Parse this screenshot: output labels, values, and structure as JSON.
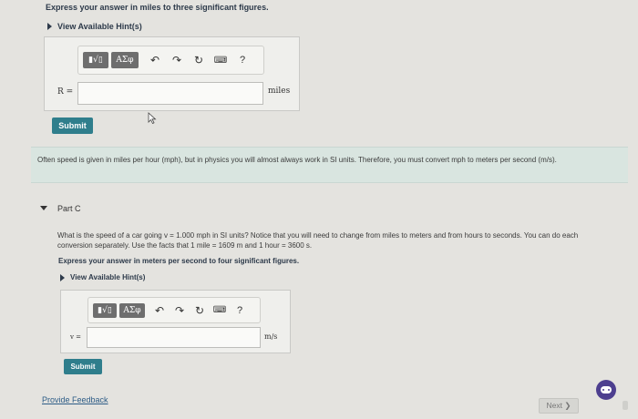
{
  "partB": {
    "instruction": "Express your answer in miles to three significant figures.",
    "hints_label": "View Available Hint(s)",
    "var_label": "R =",
    "unit": "miles",
    "submit_label": "Submit"
  },
  "toolbar": {
    "template_label": "▮√▯",
    "greek_label": "ΑΣφ",
    "help_label": "?"
  },
  "info_text": "Often speed is given in miles per hour (mph), but in physics you will almost always work in SI units. Therefore, you must convert mph to meters per second (m/s).",
  "partC": {
    "title": "Part C",
    "question": "What is the speed of a car going v = 1.000 mph in SI units? Notice that you will need to change from miles to meters and from hours to seconds. You can do each conversion separately. Use the facts that 1 mile = 1609 m and 1 hour = 3600 s.",
    "instruction": "Express your answer in meters per second to four significant figures.",
    "hints_label": "View Available Hint(s)",
    "var_label": "v =",
    "unit": "m/s",
    "submit_label": "Submit"
  },
  "footer": {
    "feedback_label": "Provide Feedback",
    "next_label": "Next ❯"
  }
}
